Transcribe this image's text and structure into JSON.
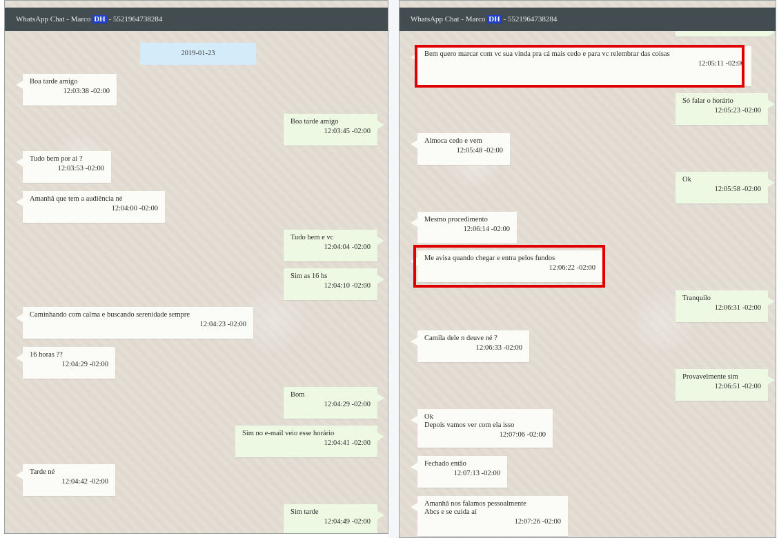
{
  "left": {
    "title_prefix": "WhatsApp Chat - Marco",
    "title_highlight": "DH",
    "title_suffix": "- 5521964738284",
    "date_label": "2019-01-23",
    "messages": [
      {
        "dir": "in",
        "text": "Boa tarde amigo",
        "time": "12:03:38 -02:00"
      },
      {
        "dir": "out",
        "text": "Boa tarde amigo",
        "time": "12:03:45 -02:00"
      },
      {
        "dir": "in",
        "text": "Tudo bem por ai ?",
        "time": "12:03:53 -02:00"
      },
      {
        "dir": "in",
        "text": "Amanhã que tem a audiência né",
        "time": "12:04:00 -02:00"
      },
      {
        "dir": "out",
        "text": "Tudo bem e vc",
        "time": "12:04:04 -02:00"
      },
      {
        "dir": "out",
        "text": "Sim as 16 hs",
        "time": "12:04:10 -02:00"
      },
      {
        "dir": "in",
        "text": "Caminhando com calma e buscando serenidade sempre",
        "time": "12:04:23 -02:00"
      },
      {
        "dir": "in",
        "text": "16 horas ??",
        "time": "12:04:29 -02:00"
      },
      {
        "dir": "out",
        "text": "Bom",
        "time": "12:04:29 -02:00"
      },
      {
        "dir": "out",
        "text": "Sim no e-mail veio esse horário",
        "time": "12:04:41 -02:00"
      },
      {
        "dir": "in",
        "text": "Tarde né",
        "time": "12:04:42 -02:00"
      },
      {
        "dir": "out",
        "text": "Sim tarde",
        "time": "12:04:49 -02:00"
      }
    ]
  },
  "right": {
    "title_prefix": "WhatsApp Chat - Marco",
    "title_highlight": "DH",
    "title_suffix": "- 5521964738284",
    "messages": [
      {
        "dir": "in",
        "text": "Bem quero marcar com vc sua vinda pra cá mais cedo e para vc relembrar das coisas",
        "time": "12:05:11 -02:00",
        "highlighted": true
      },
      {
        "dir": "out",
        "text": "Só falar o horário",
        "time": "12:05:23 -02:00"
      },
      {
        "dir": "in",
        "text": "Almoca cedo e vem",
        "time": "12:05:48 -02:00"
      },
      {
        "dir": "out",
        "text": "Ok",
        "time": "12:05:58 -02:00"
      },
      {
        "dir": "in",
        "text": "Mesmo procedimento",
        "time": "12:06:14 -02:00"
      },
      {
        "dir": "in",
        "text": "Me avisa quando chegar e entra pelos fundos",
        "time": "12:06:22 -02:00",
        "highlighted": true
      },
      {
        "dir": "out",
        "text": "Tranquilo",
        "time": "12:06:31 -02:00"
      },
      {
        "dir": "in",
        "text": "Camila dele n deuve né ?",
        "time": "12:06:33 -02:00"
      },
      {
        "dir": "out",
        "text": "Provavelmente sim",
        "time": "12:06:51 -02:00"
      },
      {
        "dir": "in",
        "text": "Ok\nDepois vamos ver com ela isso",
        "time": "12:07:06 -02:00"
      },
      {
        "dir": "in",
        "text": "Fechado então",
        "time": "12:07:13 -02:00"
      },
      {
        "dir": "in",
        "text": "Amanhã nos falamos pessoalmente\nAbcs e se cuida aí",
        "time": "12:07:26 -02:00"
      }
    ]
  }
}
